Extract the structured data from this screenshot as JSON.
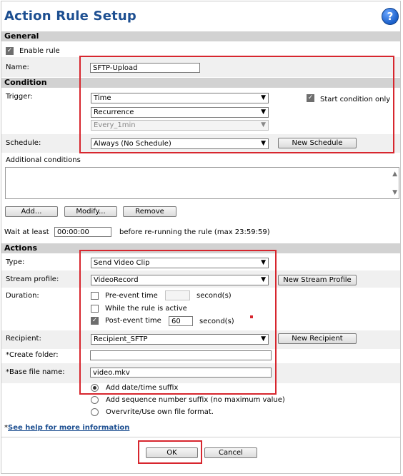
{
  "title": "Action Rule Setup",
  "help_icon": "?",
  "general": {
    "section": "General",
    "enable_rule": "Enable rule",
    "name_label": "Name:",
    "name_value": "SFTP-Upload"
  },
  "condition": {
    "section": "Condition",
    "trigger_label": "Trigger:",
    "trigger_value": "Time",
    "trigger_sub": "Recurrence",
    "trigger_sub2": "Every_1min",
    "start_condition_only": "Start condition only",
    "schedule_label": "Schedule:",
    "schedule_value": "Always (No Schedule)",
    "new_schedule": "New Schedule",
    "additional_conditions": "Additional conditions",
    "add_btn": "Add...",
    "modify_btn": "Modify...",
    "remove_btn": "Remove",
    "wait_label": "Wait at least",
    "wait_value": "00:00:00",
    "wait_suffix": "before re-running the rule (max 23:59:59)"
  },
  "actions": {
    "section": "Actions",
    "type_label": "Type:",
    "type_value": "Send Video Clip",
    "stream_label": "Stream profile:",
    "stream_value": "VideoRecord",
    "new_stream_profile": "New Stream Profile",
    "duration_label": "Duration:",
    "pre_event": "Pre-event time",
    "pre_value": "",
    "seconds1": "second(s)",
    "while_active": "While the rule is active",
    "post_event": "Post-event time",
    "post_value": "60",
    "seconds2": "second(s)",
    "recipient_label": "Recipient:",
    "recipient_value": "Recipient_SFTP",
    "new_recipient": "New Recipient",
    "create_folder_label": "*Create folder:",
    "create_folder_value": "",
    "base_file_label": "*Base file name:",
    "base_file_value": "video.mkv",
    "add_datetime": "Add date/time suffix",
    "add_sequence": "Add sequence number suffix (no maximum value)",
    "overwrite": "Overvrite/Use own file format."
  },
  "footer": {
    "star": "*",
    "help_link": "See help for more information",
    "ok": "OK",
    "cancel": "Cancel"
  },
  "colors": {
    "accent": "#1d4f91",
    "highlight": "#d7262e",
    "section_bg": "#d2d2d2",
    "row_bg": "#f0f0f0"
  }
}
